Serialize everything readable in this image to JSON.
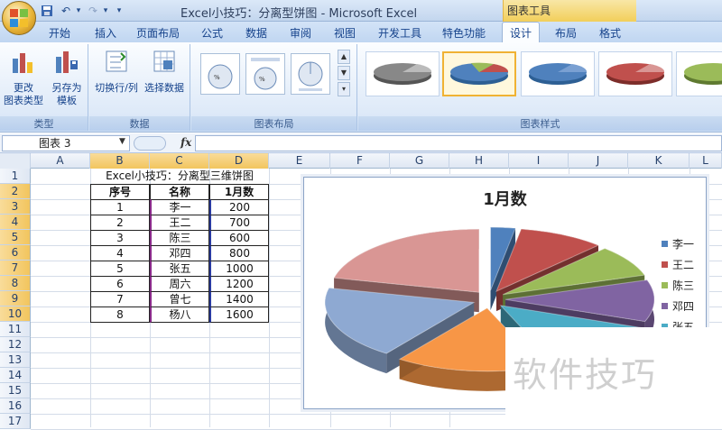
{
  "window": {
    "title": "Excel小技巧：分离型饼图 - Microsoft Excel",
    "context_tab_group": "图表工具"
  },
  "qat": {
    "undo_icon": "undo-icon",
    "redo_icon": "redo-icon",
    "save_icon": "save-icon",
    "dropdown": "▾"
  },
  "tabs": [
    "开始",
    "插入",
    "页面布局",
    "公式",
    "数据",
    "审阅",
    "视图",
    "开发工具",
    "特色功能",
    "设计",
    "布局",
    "格式"
  ],
  "active_tab": "设计",
  "ribbon": {
    "groups": {
      "type": "类型",
      "data": "数据",
      "layout": "图表布局",
      "styles": "图表样式"
    },
    "buttons": {
      "change_type": "更改\n图表类型",
      "save_template": "另存为\n模板",
      "switch_row_col": "切换行/列",
      "select_data": "选择数据"
    }
  },
  "formula_bar": {
    "name_box": "图表 3",
    "fx": "fx",
    "value": ""
  },
  "columns": [
    "A",
    "B",
    "C",
    "D",
    "E",
    "F",
    "G",
    "H",
    "I",
    "J",
    "K",
    "L"
  ],
  "rows": [
    "1",
    "2",
    "3",
    "4",
    "5",
    "6",
    "7",
    "8",
    "9",
    "10",
    "11",
    "12",
    "13",
    "14",
    "15",
    "16",
    "17"
  ],
  "sheet": {
    "title": "Excel小技巧：分离型三维饼图",
    "headers": [
      "序号",
      "名称",
      "1月数"
    ],
    "data": [
      [
        "1",
        "李一",
        "200"
      ],
      [
        "2",
        "王二",
        "700"
      ],
      [
        "3",
        "陈三",
        "600"
      ],
      [
        "4",
        "邓四",
        "800"
      ],
      [
        "5",
        "张五",
        "1000"
      ],
      [
        "6",
        "周六",
        "1200"
      ],
      [
        "7",
        "曾七",
        "1400"
      ],
      [
        "8",
        "杨八",
        "1600"
      ]
    ]
  },
  "chart_data": {
    "type": "pie",
    "title": "1月数",
    "categories": [
      "李一",
      "王二",
      "陈三",
      "邓四",
      "张五",
      "周六",
      "曾七",
      "杨八"
    ],
    "values": [
      200,
      700,
      600,
      800,
      1000,
      1200,
      1400,
      1600
    ],
    "colors": [
      "#4f81bd",
      "#c0504d",
      "#9bbb59",
      "#8064a2",
      "#4bacc6",
      "#f79646",
      "#8ea9d2",
      "#d99694"
    ],
    "legend": "right",
    "style": "3d-exploded"
  },
  "colors": {
    "accent": "#15428b",
    "selected_style": "#f0b233"
  },
  "watermark": "软件技巧"
}
